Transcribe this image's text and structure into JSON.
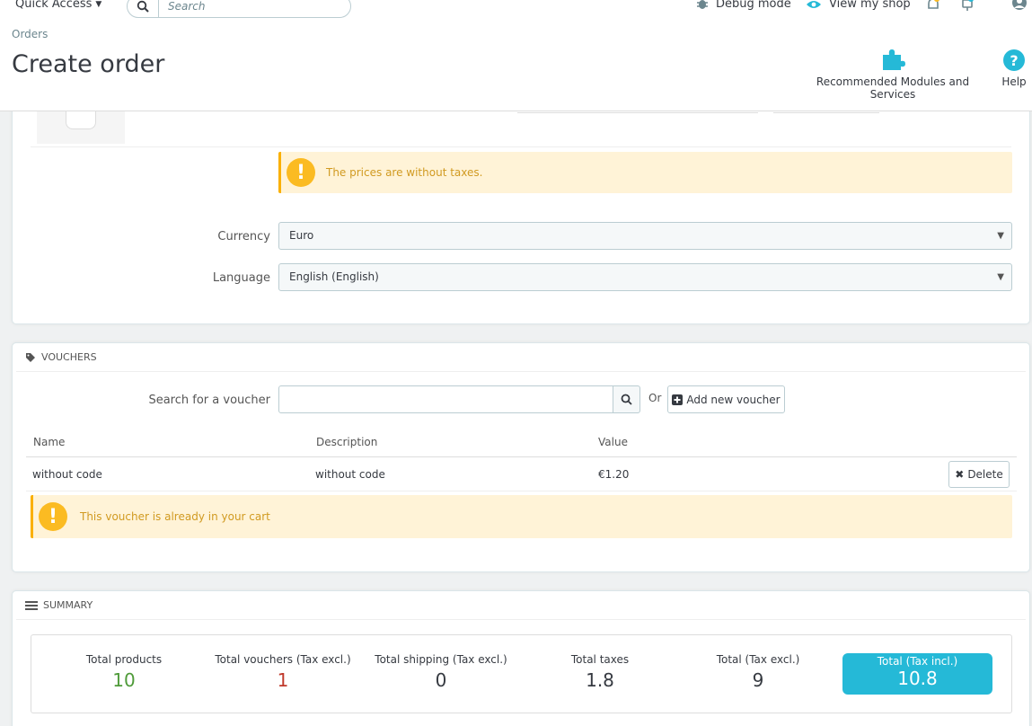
{
  "header": {
    "quick_access": "Quick Access",
    "search_placeholder": "Search",
    "debug_mode": "Debug mode",
    "view_shop": "View my shop",
    "breadcrumb": "Orders",
    "page_title": "Create order",
    "toolbar": {
      "modules": "Recommended Modules and Services",
      "help": "Help"
    }
  },
  "cart": {
    "warning": "The prices are without taxes.",
    "currency_label": "Currency",
    "currency_value": "Euro",
    "language_label": "Language",
    "language_value": "English (English)"
  },
  "vouchers": {
    "heading": "VOUCHERS",
    "search_label": "Search for a voucher",
    "or_text": "Or",
    "add_button": "Add new voucher",
    "columns": [
      "Name",
      "Description",
      "Value"
    ],
    "rows": [
      {
        "name": "without code",
        "description": "without code",
        "value": "€1.20",
        "action": "Delete"
      }
    ],
    "warning": "This voucher is already in your cart"
  },
  "summary": {
    "heading": "SUMMARY",
    "stats": [
      {
        "label": "Total products",
        "value": "10"
      },
      {
        "label": "Total vouchers (Tax excl.)",
        "value": "1"
      },
      {
        "label": "Total shipping (Tax excl.)",
        "value": "0"
      },
      {
        "label": "Total taxes",
        "value": "1.8"
      },
      {
        "label": "Total (Tax excl.)",
        "value": "9"
      }
    ],
    "total": {
      "label": "Total (Tax incl.)",
      "value": "10.8"
    }
  },
  "colors": {
    "accent": "#25b9d7",
    "products_value": "#4f9b3a",
    "vouchers_value": "#c0392b",
    "warning_bg": "#fff3d7",
    "warning_text": "#d19a21"
  }
}
